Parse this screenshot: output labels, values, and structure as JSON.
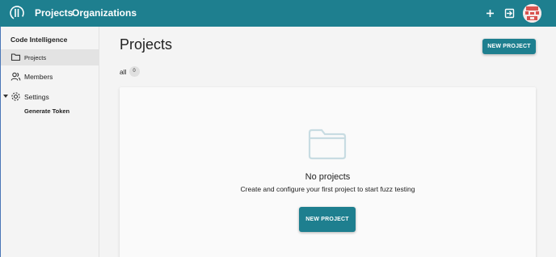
{
  "header": {
    "nav": {
      "projects": "Projects",
      "organizations": "Organizations"
    },
    "icons": {
      "logo": "app-logo",
      "add": "plus-icon",
      "exit": "exit-icon",
      "avatar": "avatar"
    },
    "background_color": "#1e7f8f"
  },
  "sidebar": {
    "header": "Code Intelligence",
    "items": [
      {
        "label": "Projects",
        "icon": "folder-icon",
        "active": true
      },
      {
        "label": "Members",
        "icon": "members-icon",
        "active": false
      },
      {
        "label": "Settings",
        "icon": "gear-icon",
        "expanded": true
      }
    ],
    "sub_items": [
      {
        "label": "Generate Token"
      }
    ]
  },
  "main": {
    "title": "Projects",
    "new_project_button": "NEW PROJECT",
    "filter": {
      "label": "all",
      "count": "0"
    },
    "empty_state": {
      "icon": "folder-icon",
      "title": "No projects",
      "description": "Create and configure your first project to start fuzz testing",
      "button": "NEW PROJECT"
    }
  },
  "colors": {
    "accent": "#1e7f8f",
    "active_item_bg": "#e3e3e3"
  }
}
